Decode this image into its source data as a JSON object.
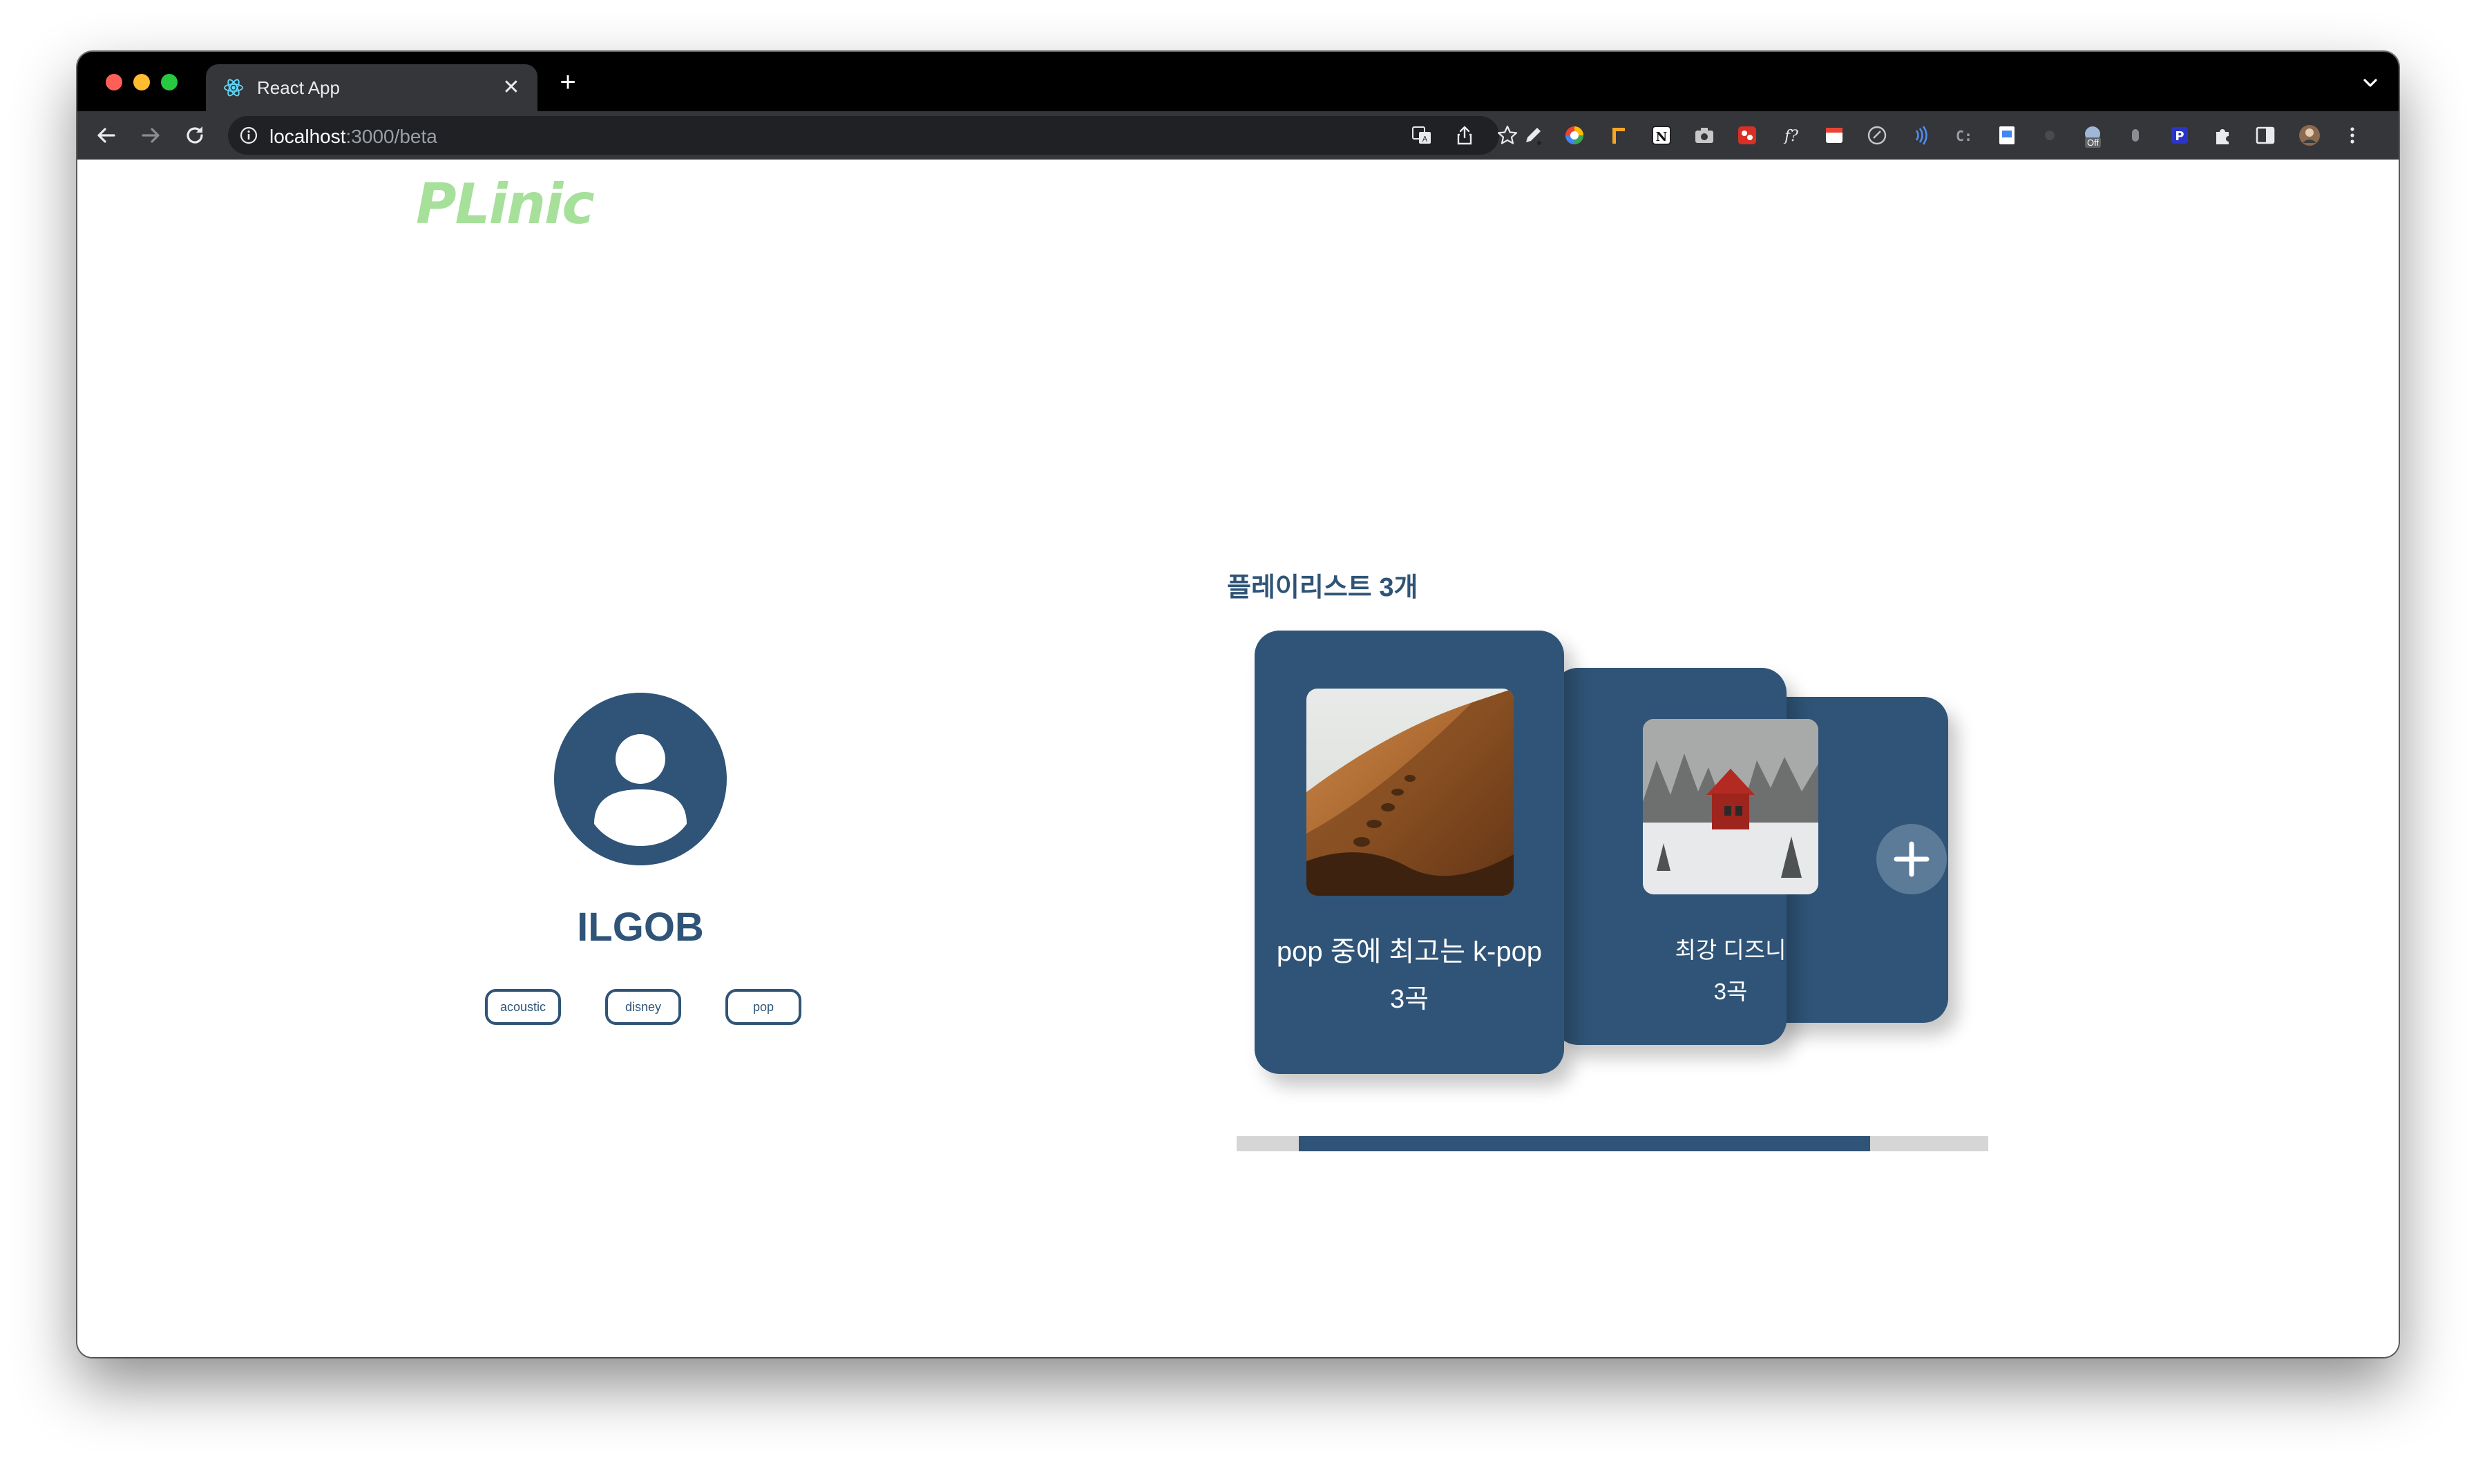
{
  "browser": {
    "tab_title": "React App",
    "url_host": "localhost",
    "url_path": ":3000/beta",
    "new_tab_glyph": "+",
    "close_glyph": "✕",
    "extension_icons": [
      "pen-icon",
      "color-wheel-icon",
      "ruler-icon",
      "notion-icon",
      "camera-icon",
      "red-ext-icon",
      "formula-icon",
      "calendar-icon",
      "link-icon",
      "broadcast-icon",
      "code-icon",
      "doc-icon",
      "dot-icon",
      "ext-off-icon",
      "grey-ext-icon",
      "p-ext-icon",
      "puzzle-icon",
      "sidepanel-icon",
      "profile-avatar",
      "menu-icon"
    ],
    "ext_badge": "Off"
  },
  "app": {
    "logo": "PLinic",
    "brand_color": "#2f5477",
    "logo_color": "#a6e09a"
  },
  "profile": {
    "username": "ILGOB",
    "tags": [
      "acoustic",
      "disney",
      "pop"
    ]
  },
  "playlists": {
    "heading": "플레이리스트 3개",
    "items": [
      {
        "name": "pop 중에 최고는 k-pop",
        "count": "3곡",
        "image": "desert-dune-photo"
      },
      {
        "name": "최강 디즈니",
        "count": "3곡",
        "image": "snowy-red-cabin-photo"
      }
    ],
    "add_label": "+"
  },
  "scrollbar": {
    "thumb_start_fraction": 0.083,
    "thumb_size_fraction": 0.76
  }
}
